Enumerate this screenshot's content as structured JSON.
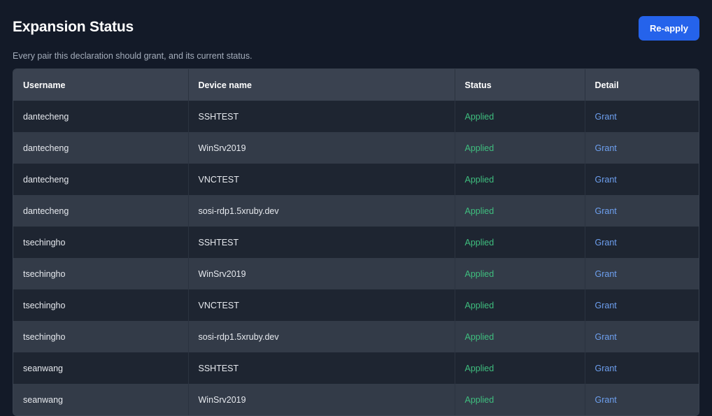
{
  "header": {
    "title": "Expansion Status",
    "reapply_label": "Re-apply",
    "subtitle": "Every pair this declaration should grant, and its current status."
  },
  "table": {
    "columns": [
      "Username",
      "Device name",
      "Status",
      "Detail"
    ],
    "rows": [
      {
        "username": "dantecheng",
        "device": "SSHTEST",
        "status": "Applied",
        "detail": "Grant"
      },
      {
        "username": "dantecheng",
        "device": "WinSrv2019",
        "status": "Applied",
        "detail": "Grant"
      },
      {
        "username": "dantecheng",
        "device": "VNCTEST",
        "status": "Applied",
        "detail": "Grant"
      },
      {
        "username": "dantecheng",
        "device": "sosi-rdp1.5xruby.dev",
        "status": "Applied",
        "detail": "Grant"
      },
      {
        "username": "tsechingho",
        "device": "SSHTEST",
        "status": "Applied",
        "detail": "Grant"
      },
      {
        "username": "tsechingho",
        "device": "WinSrv2019",
        "status": "Applied",
        "detail": "Grant"
      },
      {
        "username": "tsechingho",
        "device": "VNCTEST",
        "status": "Applied",
        "detail": "Grant"
      },
      {
        "username": "tsechingho",
        "device": "sosi-rdp1.5xruby.dev",
        "status": "Applied",
        "detail": "Grant"
      },
      {
        "username": "seanwang",
        "device": "SSHTEST",
        "status": "Applied",
        "detail": "Grant"
      },
      {
        "username": "seanwang",
        "device": "WinSrv2019",
        "status": "Applied",
        "detail": "Grant"
      }
    ]
  },
  "colors": {
    "background": "#131a28",
    "accent": "#2563eb",
    "status_applied": "#3fbf7f",
    "link": "#6ea0f0"
  }
}
